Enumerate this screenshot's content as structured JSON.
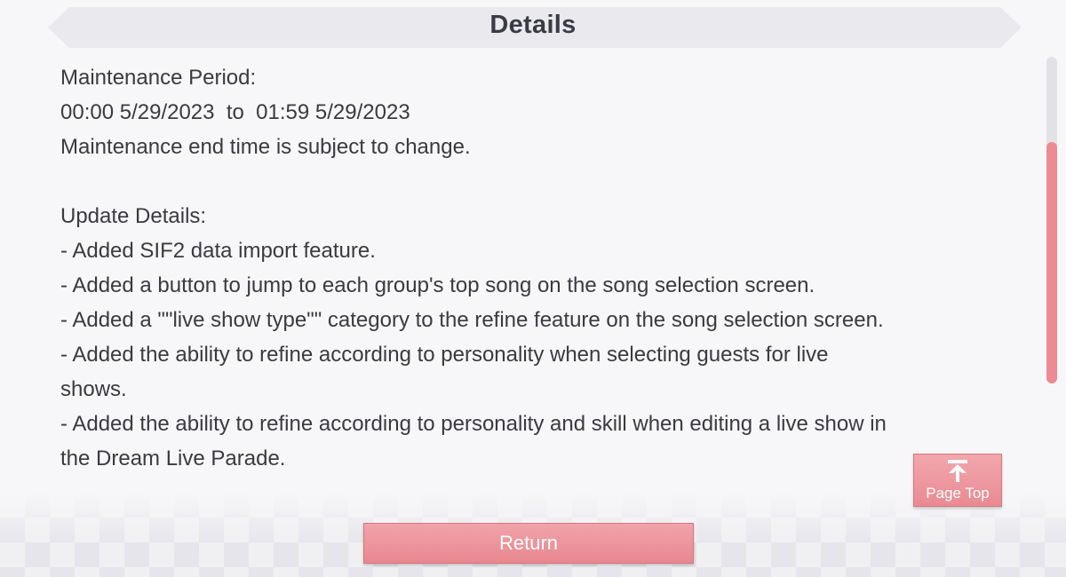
{
  "header": {
    "title": "Details"
  },
  "content": {
    "lines": [
      "Maintenance Period:",
      "00:00 5/29/2023  to  01:59 5/29/2023",
      "Maintenance end time is subject to change.",
      "",
      "Update Details:",
      "- Added SIF2 data import feature.",
      "- Added a button to jump to each group's top song on the song selection screen.",
      "- Added a \"\"live show type\"\" category to the refine feature on the song selection screen.",
      "- Added the ability to refine according to personality when selecting guests for live",
      "shows.",
      "- Added the ability to refine according to personality and skill when editing a live show in",
      "the Dream Live Parade."
    ]
  },
  "scrollbar": {
    "position": 0.26,
    "visible_fraction": 0.74
  },
  "buttons": {
    "page_top_label": "Page Top",
    "page_top_icon": "arrow-up-to-bar-icon",
    "return_label": "Return"
  },
  "colors": {
    "accent": "#ec8b94",
    "text": "#3a3a40",
    "header_bg": "#e9e9ee"
  }
}
